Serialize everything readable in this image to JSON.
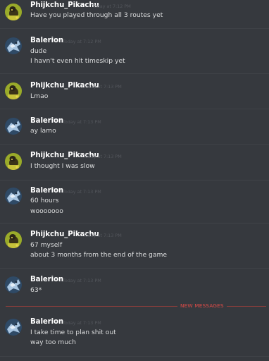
{
  "users": {
    "pikachu": {
      "name": "Phijkchu_Pikachu"
    },
    "balerion": {
      "name": "Balerion"
    }
  },
  "messages": [
    {
      "author": "Phijkchu_Pikachu",
      "time": "Today at 7:12 PM",
      "lines": [
        "Have you played through all 3 routes yet"
      ]
    },
    {
      "author": "Balerion",
      "time": "Today at 7:12 PM",
      "lines": [
        "dude",
        "I havn't even hit timeskip yet"
      ]
    },
    {
      "author": "Phijkchu_Pikachu",
      "time": "Today at 7:13 PM",
      "lines": [
        "Lmao"
      ]
    },
    {
      "author": "Balerion",
      "time": "Today at 7:13 PM",
      "lines": [
        "ay lamo"
      ]
    },
    {
      "author": "Phijkchu_Pikachu",
      "time": "Today at 7:13 PM",
      "lines": [
        "I thought I was slow"
      ]
    },
    {
      "author": "Balerion",
      "time": "Today at 7:13 PM",
      "lines": [
        "60 hours",
        "wooooooo"
      ]
    },
    {
      "author": "Phijkchu_Pikachu",
      "time": "Today at 7:13 PM",
      "lines": [
        "67 myself",
        "about 3 months from the end of the game"
      ]
    },
    {
      "author": "Balerion",
      "time": "Today at 7:13 PM",
      "lines": [
        "63*"
      ]
    },
    {
      "author": "Balerion",
      "time": "Today at 7:13 PM",
      "lines": [
        "I take time to plan shit out",
        "way too much"
      ]
    }
  ],
  "divider": {
    "label": "NEW MESSAGES",
    "color": "#e04b47"
  },
  "theme": {
    "background": "#36393e",
    "username_color": "#ffffff",
    "text_color": "#dcddde",
    "timestamp_color": "#53565c"
  }
}
